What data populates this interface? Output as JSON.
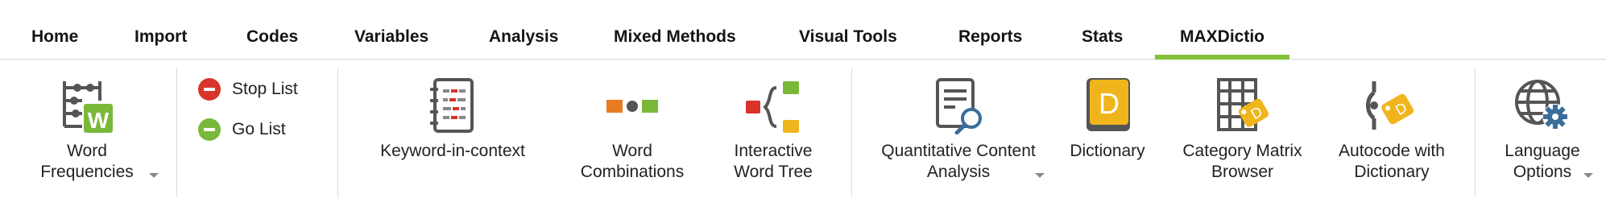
{
  "tabs": [
    {
      "label": "Home"
    },
    {
      "label": "Import"
    },
    {
      "label": "Codes"
    },
    {
      "label": "Variables"
    },
    {
      "label": "Analysis"
    },
    {
      "label": "Mixed Methods"
    },
    {
      "label": "Visual Tools"
    },
    {
      "label": "Reports"
    },
    {
      "label": "Stats"
    },
    {
      "label": "MAXDictio",
      "active": true
    }
  ],
  "colors": {
    "accent": "#84c13a",
    "red": "#d8342c",
    "green": "#7ab83a",
    "orange": "#e97b22",
    "yellow": "#f0b51c",
    "gray": "#555555",
    "blue": "#3a6d9a"
  },
  "ribbon": {
    "word_frequencies": {
      "line1": "Word",
      "line2": "Frequencies",
      "icon": "word-frequencies-icon"
    },
    "stop_list": {
      "label": "Stop List",
      "icon": "minus-circle-red-icon"
    },
    "go_list": {
      "label": "Go List",
      "icon": "minus-circle-green-icon"
    },
    "keyword_in_context": {
      "line1": "Keyword-in-context",
      "icon": "keyword-in-context-icon"
    },
    "word_combinations": {
      "line1": "Word",
      "line2": "Combinations",
      "icon": "word-combinations-icon"
    },
    "interactive_word_tree": {
      "line1": "Interactive",
      "line2": "Word Tree",
      "icon": "word-tree-icon"
    },
    "quantitative_content_analysis": {
      "line1": "Quantitative Content",
      "line2": "Analysis",
      "icon": "document-search-icon"
    },
    "dictionary": {
      "line1": "Dictionary",
      "icon": "dictionary-book-icon"
    },
    "category_matrix_browser": {
      "line1": "Category Matrix",
      "line2": "Browser",
      "icon": "category-matrix-icon"
    },
    "autocode_with_dictionary": {
      "line1": "Autocode with",
      "line2": "Dictionary",
      "icon": "autocode-dictionary-icon"
    },
    "language_options": {
      "line1": "Language",
      "line2": "Options",
      "icon": "globe-gear-icon"
    }
  }
}
